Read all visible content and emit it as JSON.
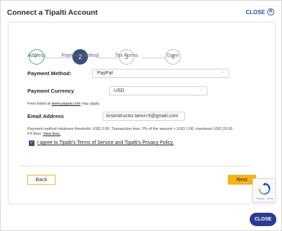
{
  "header": {
    "title": "Connect a Tipalti Account",
    "close_label": "CLOSE",
    "close_icon": "circle-x-icon"
  },
  "steps": [
    {
      "number": "",
      "label": "Address",
      "state": "done",
      "icon": "check-icon"
    },
    {
      "number": "2",
      "label": "Payment Method",
      "state": "active"
    },
    {
      "number": "3",
      "label": "Tax Forms",
      "state": "pending"
    },
    {
      "number": "4",
      "label": "Done",
      "state": "pending"
    }
  ],
  "form": {
    "payment_method_label": "Payment Method:",
    "payment_method_value": "PayPal",
    "currency_label": "Payment Currency",
    "currency_value": "USD",
    "fees_prefix": "Fees listed at",
    "fees_link": "www.paypal.com",
    "fees_suffix": "may apply.",
    "email_label": "Email Address",
    "email_value": "iicsinstructor.tanvi+5@gmail.com",
    "threshold_text": "Payment method minimum threshold: USD 2.00. Transaction fees: 2% of the amount + USD 1.00, maximum USD 20.00.",
    "fx_prefix": "FX fees:",
    "fx_link": "View fees.",
    "agree_checked": true,
    "agree_text": "I agree to Tipalti's Terms of Service and Tipalti's Privacy Policy."
  },
  "footer": {
    "back_label": "Back",
    "next_label": "Next",
    "recaptcha_text": "Privacy - Terms",
    "close_label": "CLOSE"
  },
  "colors": {
    "accent": "#3e4e7a",
    "done": "#3bb273",
    "next_button": "#f7b21a",
    "close_button": "#2b3b94",
    "link": "#2a4fa8"
  }
}
